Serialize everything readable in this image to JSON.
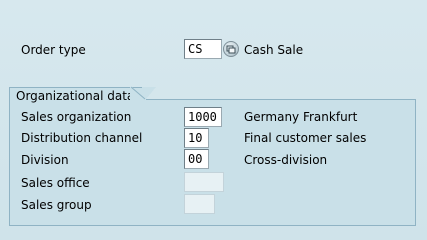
{
  "header": {
    "order_type_label": "Order type",
    "order_type_value": "CS",
    "order_type_description": "Cash Sale"
  },
  "org_data": {
    "title": "Organizational data",
    "fields": [
      {
        "label": "Sales organization",
        "value": "1000",
        "description": "Germany Frankfurt"
      },
      {
        "label": "Distribution channel",
        "value": "10",
        "description": "Final customer sales"
      },
      {
        "label": "Division",
        "value": "00",
        "description": "Cross-division"
      },
      {
        "label": "Sales office",
        "value": "",
        "description": ""
      },
      {
        "label": "Sales group",
        "value": "",
        "description": ""
      }
    ]
  },
  "icons": {
    "order_type_f4": "value-help-icon"
  },
  "colors": {
    "background": "#d7e8ee",
    "group_box": "#c9e0e8",
    "group_border": "#8fb3c4",
    "field_bg": "#ffffff"
  }
}
